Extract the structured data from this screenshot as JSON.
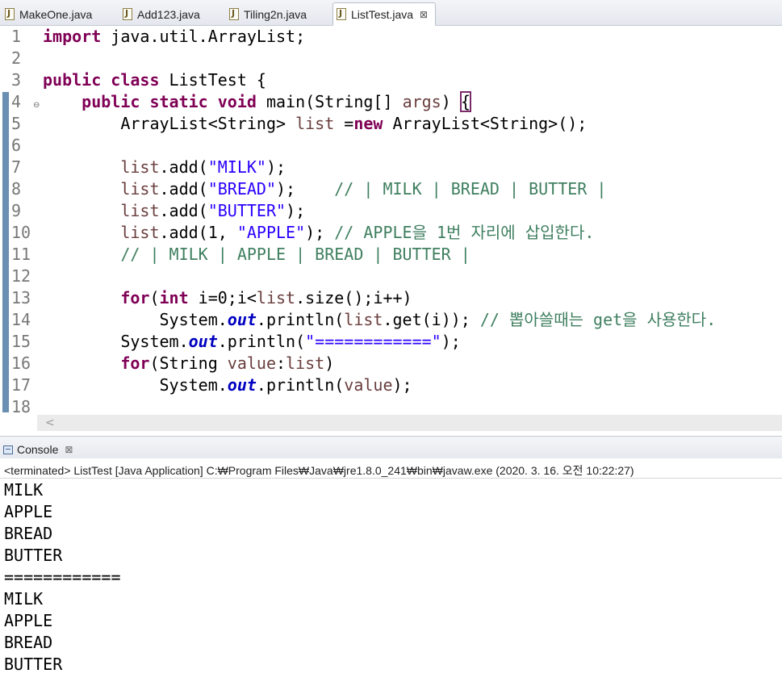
{
  "tabs": [
    {
      "label": "MakeOne.java",
      "icon": "java-file-icon"
    },
    {
      "label": "Add123.java",
      "icon": "java-file-icon"
    },
    {
      "label": "Tiling2n.java",
      "icon": "java-file-icon"
    },
    {
      "label": "ListTest.java",
      "icon": "java-file-icon",
      "active": true,
      "close": "⊠"
    }
  ],
  "editor": {
    "line_numbers": [
      "1",
      "2",
      "3",
      "4",
      "5",
      "6",
      "7",
      "8",
      "9",
      "10",
      "11",
      "12",
      "13",
      "14",
      "15",
      "16",
      "17",
      "18"
    ],
    "fold_marker": "⊖",
    "code": {
      "l1_kw": "import",
      "l1_rest": " java.util.ArrayList;",
      "l3_kw1": "public",
      "l3_kw2": "class",
      "l3_rest": " ListTest {",
      "l4_indent": "    ",
      "l4_kw1": "public",
      "l4_kw2": "static",
      "l4_kw3": "void",
      "l4_mid": " main(String[] ",
      "l4_var": "args",
      "l4_end": ") ",
      "l4_brace": "{",
      "l5_a": "        ArrayList<String> ",
      "l5_var": "list",
      "l5_b": " =",
      "l5_kw": "new",
      "l5_c": " ArrayList<String>();",
      "l7_var": "list",
      "l7_a": ".add(",
      "l7_str": "\"MILK\"",
      "l7_b": ");",
      "l8_var": "list",
      "l8_a": ".add(",
      "l8_str": "\"BREAD\"",
      "l8_b": ");    ",
      "l8_cmt": "// | MILK | BREAD | BUTTER |",
      "l9_var": "list",
      "l9_a": ".add(",
      "l9_str": "\"BUTTER\"",
      "l9_b": ");",
      "l10_var": "list",
      "l10_a": ".add(1, ",
      "l10_str": "\"APPLE\"",
      "l10_b": "); ",
      "l10_cmt": "// APPLE을 1번 자리에 삽입한다.",
      "l11_cmt": "// | MILK | APPLE | BREAD | BUTTER |",
      "l13_kw1": "for",
      "l13_a": "(",
      "l13_kw2": "int",
      "l13_b": " i=0;i<",
      "l13_var": "list",
      "l13_c": ".size();i++)",
      "l14_a": "            System.",
      "l14_fld": "out",
      "l14_b": ".println(",
      "l14_var": "list",
      "l14_c": ".get(i)); ",
      "l14_cmt": "// 뽑아쓸때는 get을 사용한다.",
      "l15_a": "        System.",
      "l15_fld": "out",
      "l15_b": ".println(",
      "l15_str": "\"============\"",
      "l15_c": ");",
      "l16_kw": "for",
      "l16_a": "(String ",
      "l16_var1": "value",
      "l16_b": ":",
      "l16_var2": "list",
      "l16_c": ")",
      "l17_a": "            System.",
      "l17_fld": "out",
      "l17_b": ".println(",
      "l17_var": "value",
      "l17_c": ");"
    },
    "scroll_arrow": "<"
  },
  "console": {
    "tab_label": "Console",
    "close": "⊠",
    "status": "<terminated> ListTest [Java Application] C:₩Program Files₩Java₩jre1.8.0_241₩bin₩javaw.exe (2020. 3. 16. 오전 10:22:27)",
    "output": [
      "MILK",
      "APPLE",
      "BREAD",
      "BUTTER",
      "============",
      "MILK",
      "APPLE",
      "BREAD",
      "BUTTER"
    ]
  },
  "colors": {
    "keyword": "#7f0055",
    "string": "#2a00ff",
    "comment": "#3f7f5f",
    "local_var": "#6a3e3e",
    "static_field": "#0000c0"
  }
}
